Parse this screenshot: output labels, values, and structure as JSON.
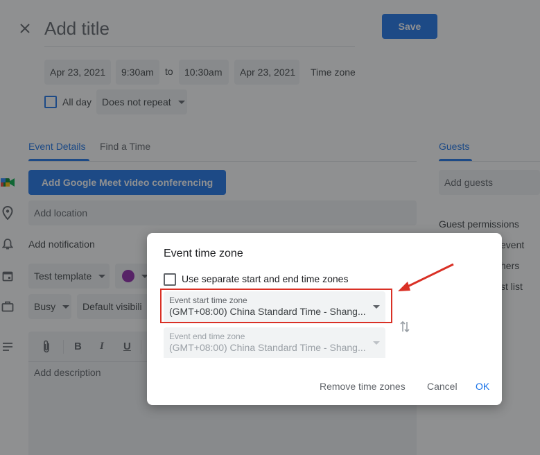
{
  "header": {
    "title_placeholder": "Add title",
    "save_label": "Save"
  },
  "datetime": {
    "start_date": "Apr 23, 2021",
    "start_time": "9:30am",
    "to_label": "to",
    "end_time": "10:30am",
    "end_date": "Apr 23, 2021",
    "timezone_label": "Time zone",
    "all_day_label": "All day",
    "repeat_value": "Does not repeat"
  },
  "tabs": {
    "event_details": "Event Details",
    "find_time": "Find a Time",
    "guests": "Guests"
  },
  "details": {
    "meet_button": "Add Google Meet video conferencing",
    "location_placeholder": "Add location",
    "notification_label": "Add notification",
    "template_value": "Test template",
    "busy_value": "Busy",
    "visibility_value": "Default visibili",
    "description_placeholder": "Add description",
    "format_buttons": [
      "B",
      "I",
      "U"
    ]
  },
  "guests": {
    "add_placeholder": "Add guests",
    "permissions_label": "Guest permissions",
    "perm_1": "event",
    "perm_2": "hers",
    "perm_3": "st list"
  },
  "dialog": {
    "title": "Event time zone",
    "separate_label": "Use separate start and end time zones",
    "start_label": "Event start time zone",
    "start_value": "(GMT+08:00) China Standard Time - Shang...",
    "end_label": "Event end time zone",
    "end_value": "(GMT+08:00) China Standard Time - Shang...",
    "remove_label": "Remove time zones",
    "cancel_label": "Cancel",
    "ok_label": "OK"
  },
  "colors": {
    "accent": "#1a73e8",
    "highlight": "#d93025",
    "event_color": "#8e24aa"
  }
}
